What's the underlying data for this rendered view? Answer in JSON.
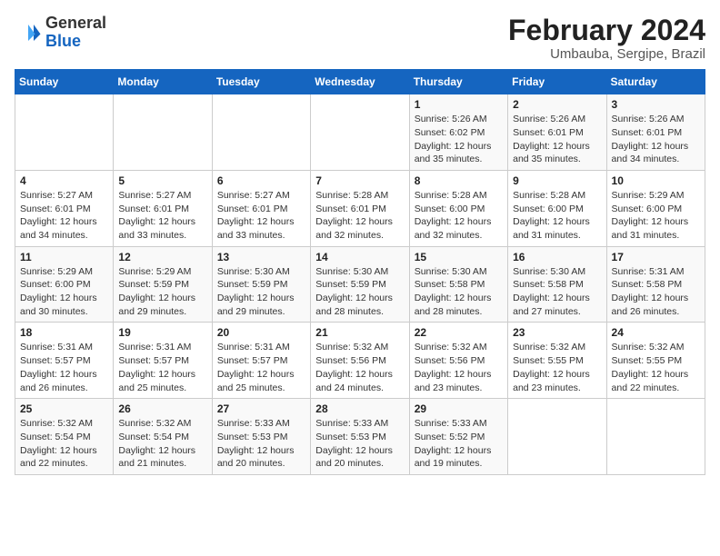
{
  "header": {
    "logo_general": "General",
    "logo_blue": "Blue",
    "main_title": "February 2024",
    "sub_title": "Umbauba, Sergipe, Brazil"
  },
  "calendar": {
    "days_of_week": [
      "Sunday",
      "Monday",
      "Tuesday",
      "Wednesday",
      "Thursday",
      "Friday",
      "Saturday"
    ],
    "weeks": [
      [
        {
          "day": "",
          "info": ""
        },
        {
          "day": "",
          "info": ""
        },
        {
          "day": "",
          "info": ""
        },
        {
          "day": "",
          "info": ""
        },
        {
          "day": "1",
          "info": "Sunrise: 5:26 AM\nSunset: 6:02 PM\nDaylight: 12 hours and 35 minutes."
        },
        {
          "day": "2",
          "info": "Sunrise: 5:26 AM\nSunset: 6:01 PM\nDaylight: 12 hours and 35 minutes."
        },
        {
          "day": "3",
          "info": "Sunrise: 5:26 AM\nSunset: 6:01 PM\nDaylight: 12 hours and 34 minutes."
        }
      ],
      [
        {
          "day": "4",
          "info": "Sunrise: 5:27 AM\nSunset: 6:01 PM\nDaylight: 12 hours and 34 minutes."
        },
        {
          "day": "5",
          "info": "Sunrise: 5:27 AM\nSunset: 6:01 PM\nDaylight: 12 hours and 33 minutes."
        },
        {
          "day": "6",
          "info": "Sunrise: 5:27 AM\nSunset: 6:01 PM\nDaylight: 12 hours and 33 minutes."
        },
        {
          "day": "7",
          "info": "Sunrise: 5:28 AM\nSunset: 6:01 PM\nDaylight: 12 hours and 32 minutes."
        },
        {
          "day": "8",
          "info": "Sunrise: 5:28 AM\nSunset: 6:00 PM\nDaylight: 12 hours and 32 minutes."
        },
        {
          "day": "9",
          "info": "Sunrise: 5:28 AM\nSunset: 6:00 PM\nDaylight: 12 hours and 31 minutes."
        },
        {
          "day": "10",
          "info": "Sunrise: 5:29 AM\nSunset: 6:00 PM\nDaylight: 12 hours and 31 minutes."
        }
      ],
      [
        {
          "day": "11",
          "info": "Sunrise: 5:29 AM\nSunset: 6:00 PM\nDaylight: 12 hours and 30 minutes."
        },
        {
          "day": "12",
          "info": "Sunrise: 5:29 AM\nSunset: 5:59 PM\nDaylight: 12 hours and 29 minutes."
        },
        {
          "day": "13",
          "info": "Sunrise: 5:30 AM\nSunset: 5:59 PM\nDaylight: 12 hours and 29 minutes."
        },
        {
          "day": "14",
          "info": "Sunrise: 5:30 AM\nSunset: 5:59 PM\nDaylight: 12 hours and 28 minutes."
        },
        {
          "day": "15",
          "info": "Sunrise: 5:30 AM\nSunset: 5:58 PM\nDaylight: 12 hours and 28 minutes."
        },
        {
          "day": "16",
          "info": "Sunrise: 5:30 AM\nSunset: 5:58 PM\nDaylight: 12 hours and 27 minutes."
        },
        {
          "day": "17",
          "info": "Sunrise: 5:31 AM\nSunset: 5:58 PM\nDaylight: 12 hours and 26 minutes."
        }
      ],
      [
        {
          "day": "18",
          "info": "Sunrise: 5:31 AM\nSunset: 5:57 PM\nDaylight: 12 hours and 26 minutes."
        },
        {
          "day": "19",
          "info": "Sunrise: 5:31 AM\nSunset: 5:57 PM\nDaylight: 12 hours and 25 minutes."
        },
        {
          "day": "20",
          "info": "Sunrise: 5:31 AM\nSunset: 5:57 PM\nDaylight: 12 hours and 25 minutes."
        },
        {
          "day": "21",
          "info": "Sunrise: 5:32 AM\nSunset: 5:56 PM\nDaylight: 12 hours and 24 minutes."
        },
        {
          "day": "22",
          "info": "Sunrise: 5:32 AM\nSunset: 5:56 PM\nDaylight: 12 hours and 23 minutes."
        },
        {
          "day": "23",
          "info": "Sunrise: 5:32 AM\nSunset: 5:55 PM\nDaylight: 12 hours and 23 minutes."
        },
        {
          "day": "24",
          "info": "Sunrise: 5:32 AM\nSunset: 5:55 PM\nDaylight: 12 hours and 22 minutes."
        }
      ],
      [
        {
          "day": "25",
          "info": "Sunrise: 5:32 AM\nSunset: 5:54 PM\nDaylight: 12 hours and 22 minutes."
        },
        {
          "day": "26",
          "info": "Sunrise: 5:32 AM\nSunset: 5:54 PM\nDaylight: 12 hours and 21 minutes."
        },
        {
          "day": "27",
          "info": "Sunrise: 5:33 AM\nSunset: 5:53 PM\nDaylight: 12 hours and 20 minutes."
        },
        {
          "day": "28",
          "info": "Sunrise: 5:33 AM\nSunset: 5:53 PM\nDaylight: 12 hours and 20 minutes."
        },
        {
          "day": "29",
          "info": "Sunrise: 5:33 AM\nSunset: 5:52 PM\nDaylight: 12 hours and 19 minutes."
        },
        {
          "day": "",
          "info": ""
        },
        {
          "day": "",
          "info": ""
        }
      ]
    ]
  }
}
